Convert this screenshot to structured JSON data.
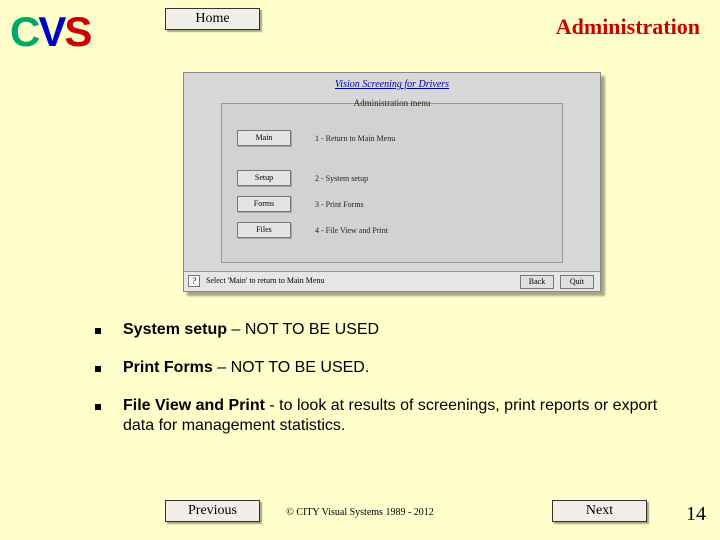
{
  "logo": {
    "c": "C",
    "v": "V",
    "s": "S"
  },
  "home_label": "Home",
  "page_title": "Administration",
  "shot": {
    "title": "Vision Screening for Drivers",
    "panel_title": "Administration menu",
    "buttons": [
      "Main",
      "Setup",
      "Forms",
      "Files"
    ],
    "rows": [
      "1 - Return to Main Menu",
      "2 - System setup",
      "3 - Print Forms",
      "4 - File View and Print"
    ],
    "status_hint": "Select 'Main' to return to Main Menu",
    "back": "Back",
    "quit": "Quit",
    "q": "?"
  },
  "bullets": [
    {
      "label": "System setup",
      "suffix": " – NOT TO BE USED"
    },
    {
      "label": "Print Forms",
      "suffix": " – NOT TO BE USED."
    },
    {
      "label": "File View and Print ",
      "suffix": " - to look at results of screenings, print reports or export data for management statistics."
    }
  ],
  "prev_label": "Previous",
  "next_label": "Next",
  "copyright": "© CITY Visual Systems 1989 - 2012",
  "page_num": "14"
}
